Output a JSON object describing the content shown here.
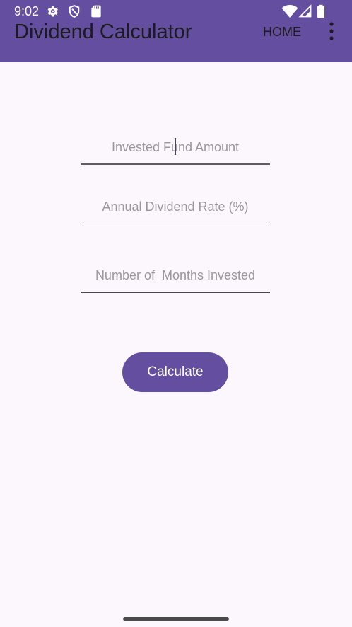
{
  "status_bar": {
    "time": "9:02",
    "icons_left": [
      "settings-icon",
      "shield-icon",
      "sd-card-icon"
    ],
    "icons_right": [
      "wifi-icon",
      "cell-signal-icon",
      "battery-icon"
    ]
  },
  "toolbar": {
    "title": "Dividend Calculator",
    "action_label": "HOME",
    "overflow_icon": "more-vert-icon",
    "background_color": "#644e9f"
  },
  "form": {
    "fields": [
      {
        "name": "invested-fund-amount",
        "placeholder": "Invested Fund Amount",
        "value": "",
        "focused": true
      },
      {
        "name": "annual-dividend-rate",
        "placeholder": "Annual Dividend Rate (%)",
        "value": ""
      },
      {
        "name": "months-invested",
        "placeholder": "Number of  Months Invested",
        "value": ""
      }
    ],
    "button_label": "Calculate",
    "button_color": "#644e9f"
  },
  "colors": {
    "background": "#fcf7fd",
    "accent": "#644e9f",
    "placeholder": "#9a979c"
  }
}
